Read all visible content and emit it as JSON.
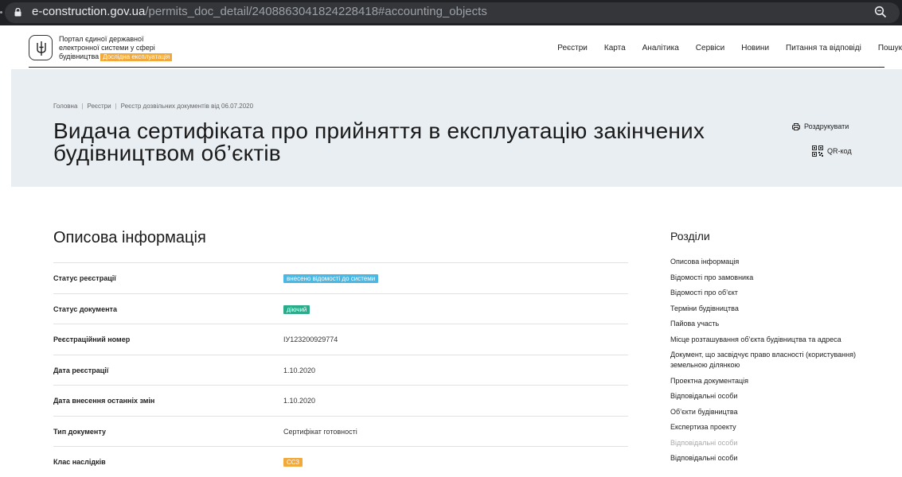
{
  "browser": {
    "url_host": "e-construction.gov.ua",
    "url_path": "/permits_doc_detail/2408863041824228418#accounting_objects"
  },
  "header": {
    "brand_lines": [
      "Портал єдиної державної",
      "електронної системи у сфері",
      "будівництва"
    ],
    "beta_badge": "Дослідна експлуатація",
    "nav": [
      "Реєстри",
      "Карта",
      "Аналітика",
      "Сервіси",
      "Новини",
      "Питання та відповіді",
      "Пошук"
    ]
  },
  "breadcrumb": [
    "Головна",
    "Реєстри",
    "Реєстр дозвільних документів від 06.07.2020"
  ],
  "page_title": "Видача сертифіката про прийняття в експлуатацію закінчених будівництвом об’єктів",
  "actions": {
    "print": "Роздрукувати",
    "qr": "QR-код"
  },
  "section_title": "Описова інформація",
  "info_rows": [
    {
      "label": "Статус реєстрації",
      "value": "внесено відомості до системи",
      "pill": "#4ab8e3"
    },
    {
      "label": "Статус документа",
      "value": "діючий",
      "pill": "#2bab8a"
    },
    {
      "label": "Реєстраційний номер",
      "value": "ІУ123200929774"
    },
    {
      "label": "Дата реєстрації",
      "value": "1.10.2020"
    },
    {
      "label": "Дата внесення останніх змін",
      "value": "1.10.2020"
    },
    {
      "label": "Тип документу",
      "value": "Сертифікат готовності"
    },
    {
      "label": "Клас наслідків",
      "value": "СС3",
      "pill": "#f2a93b"
    }
  ],
  "sections": {
    "title": "Розділи",
    "items": [
      {
        "label": "Описова інформація"
      },
      {
        "label": "Відомості про замовника"
      },
      {
        "label": "Відомості про об’єкт"
      },
      {
        "label": "Терміни будівництва"
      },
      {
        "label": "Пайова участь"
      },
      {
        "label": "Місце розташування об’єкта будівництва та адреса"
      },
      {
        "label": "Документ, що засвідчує право власності (користування) земельною ділянкою"
      },
      {
        "label": "Проектна документація"
      },
      {
        "label": "Відповідальні особи"
      },
      {
        "label": "Об’єкти будівництва"
      },
      {
        "label": "Експертиза проекту"
      },
      {
        "label": "Відповідальні особи",
        "muted": true
      },
      {
        "label": "Відповідальні особи"
      }
    ]
  }
}
